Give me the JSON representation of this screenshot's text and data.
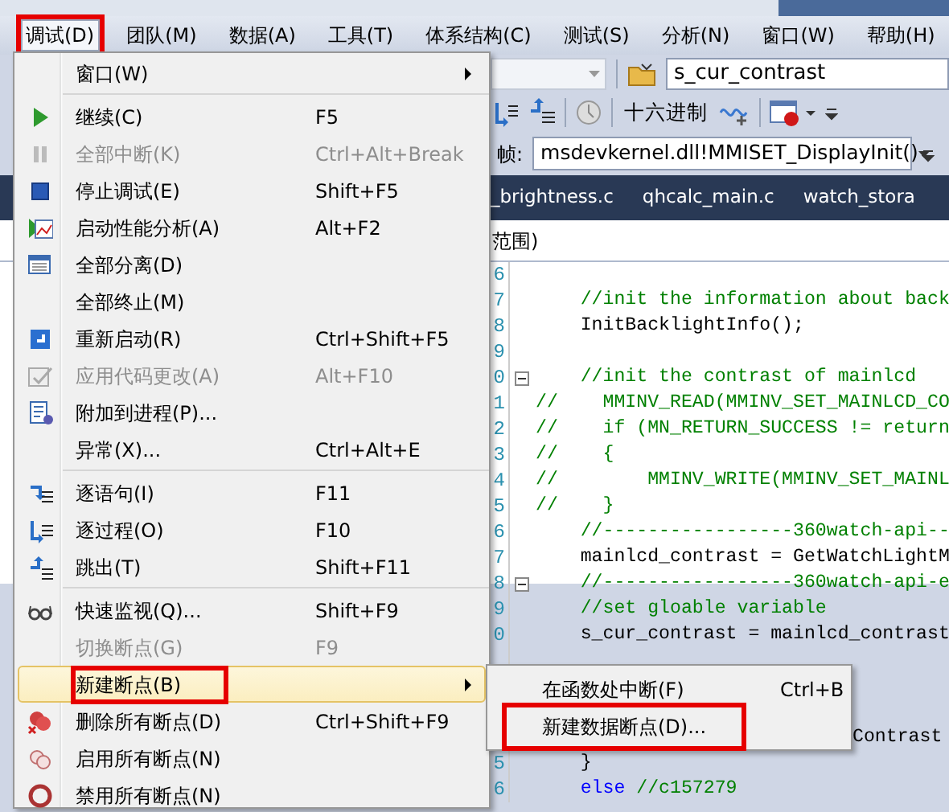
{
  "menubar": [
    {
      "label": "调试(D)",
      "selected": true,
      "annotated": true
    },
    {
      "label": "团队(M)",
      "selected": false,
      "annotated": false
    },
    {
      "label": "数据(A)",
      "selected": false,
      "annotated": false
    },
    {
      "label": "工具(T)",
      "selected": false,
      "annotated": false
    },
    {
      "label": "体系结构(C)",
      "selected": false,
      "annotated": false
    },
    {
      "label": "测试(S)",
      "selected": false,
      "annotated": false
    },
    {
      "label": "分析(N)",
      "selected": false,
      "annotated": false
    },
    {
      "label": "窗口(W)",
      "selected": false,
      "annotated": false
    },
    {
      "label": "帮助(H)",
      "selected": false,
      "annotated": false
    }
  ],
  "toolbar": {
    "find_field": {
      "value": "s_cur_contrast"
    },
    "hex_button": "十六进制",
    "frame_label": "帧:",
    "frame_dropdown": {
      "value": "msdevkernel.dll!MMISET_DisplayInit()"
    }
  },
  "tabs": [
    {
      "label": "_brightness.c"
    },
    {
      "label": "qhcalc_main.c"
    },
    {
      "label": "watch_stora"
    }
  ],
  "scope_text": "范围)",
  "code_lines": [
    {
      "kind": "full",
      "number": "6",
      "fold": false
    },
    {
      "kind": "full",
      "number": "7",
      "fold": false,
      "tokens": [
        {
          "kind": "comment",
          "text": "    //init the information about back"
        }
      ]
    },
    {
      "kind": "full",
      "number": "8",
      "fold": false,
      "tokens": [
        {
          "kind": "code",
          "text": "    InitBacklightInfo();"
        }
      ]
    },
    {
      "kind": "full",
      "number": "9",
      "fold": false
    },
    {
      "kind": "full",
      "number": "0",
      "fold": true,
      "tokens": [
        {
          "kind": "comment",
          "text": "    //init the contrast of mainlcd"
        }
      ]
    },
    {
      "kind": "full",
      "number": "1",
      "fold": false,
      "tokens": [
        {
          "kind": "comment",
          "text": "//    MMINV_READ(MMINV_SET_MAINLCD_CO"
        }
      ]
    },
    {
      "kind": "full",
      "number": "2",
      "fold": false,
      "tokens": [
        {
          "kind": "comment",
          "text": "//    if (MN_RETURN_SUCCESS != return"
        }
      ]
    },
    {
      "kind": "full",
      "number": "3",
      "fold": false,
      "tokens": [
        {
          "kind": "comment",
          "text": "//    {"
        }
      ]
    },
    {
      "kind": "full",
      "number": "4",
      "fold": false,
      "tokens": [
        {
          "kind": "comment",
          "text": "//        MMINV_WRITE(MMINV_SET_MAINL"
        }
      ]
    },
    {
      "kind": "full",
      "number": "5",
      "fold": false,
      "tokens": [
        {
          "kind": "comment",
          "text": "//    }"
        }
      ]
    },
    {
      "kind": "full",
      "number": "6",
      "fold": false,
      "tokens": [
        {
          "kind": "comment",
          "text": "    //-----------------360watch-api--"
        }
      ]
    },
    {
      "kind": "full",
      "number": "7",
      "fold": false,
      "tokens": [
        {
          "kind": "code",
          "text": "    mainlcd_contrast = GetWatchLightM"
        }
      ]
    },
    {
      "kind": "full",
      "number": "8",
      "fold": true,
      "tokens": [
        {
          "kind": "comment",
          "text": "    //-----------------360watch-api-e"
        }
      ]
    },
    {
      "kind": "full",
      "number": "9",
      "fold": false,
      "tokens": [
        {
          "kind": "comment",
          "text": "    //set gloable variable"
        }
      ]
    },
    {
      "kind": "full",
      "number": "0",
      "fold": false,
      "tokens": [
        {
          "kind": "code",
          "text": "    s_cur_contrast = mainlcd_contrast"
        }
      ]
    },
    {
      "kind": "covered"
    },
    {
      "kind": "covered"
    },
    {
      "kind": "covered"
    },
    {
      "kind": "covered",
      "tokens": [
        {
          "kind": "code",
          "text": "Contrast"
        }
      ]
    },
    {
      "kind": "full",
      "number": "5",
      "fold": false,
      "tokens": [
        {
          "kind": "code",
          "text": "    }"
        }
      ]
    },
    {
      "kind": "full",
      "number": "6",
      "fold": false,
      "tokens": [
        {
          "kind": "keyword",
          "text": "    else"
        },
        {
          "kind": "comment",
          "text": " //c157279"
        }
      ]
    }
  ],
  "debug_menu": {
    "items": [
      {
        "kind": "item",
        "label": "窗口(W)",
        "has_submenu": true,
        "disabled": false,
        "highlighted": false,
        "annotated": false
      },
      {
        "kind": "separator"
      },
      {
        "kind": "item",
        "label": "继续(C)",
        "shortcut": "F5",
        "has_submenu": false,
        "disabled": false,
        "highlighted": false,
        "annotated": false
      },
      {
        "kind": "item",
        "label": "全部中断(K)",
        "shortcut": "Ctrl+Alt+Break",
        "has_submenu": false,
        "disabled": true,
        "highlighted": false,
        "annotated": false
      },
      {
        "kind": "item",
        "label": "停止调试(E)",
        "shortcut": "Shift+F5",
        "has_submenu": false,
        "disabled": false,
        "highlighted": false,
        "annotated": false
      },
      {
        "kind": "item",
        "label": "启动性能分析(A)",
        "shortcut": "Alt+F2",
        "has_submenu": false,
        "disabled": false,
        "highlighted": false,
        "annotated": false
      },
      {
        "kind": "item",
        "label": "全部分离(D)",
        "has_submenu": false,
        "disabled": false,
        "highlighted": false,
        "annotated": false
      },
      {
        "kind": "item",
        "label": "全部终止(M)",
        "has_submenu": false,
        "disabled": false,
        "highlighted": false,
        "annotated": false
      },
      {
        "kind": "item",
        "label": "重新启动(R)",
        "shortcut": "Ctrl+Shift+F5",
        "has_submenu": false,
        "disabled": false,
        "highlighted": false,
        "annotated": false
      },
      {
        "kind": "item",
        "label": "应用代码更改(A)",
        "shortcut": "Alt+F10",
        "has_submenu": false,
        "disabled": true,
        "highlighted": false,
        "annotated": false
      },
      {
        "kind": "item",
        "label": "附加到进程(P)...",
        "has_submenu": false,
        "disabled": false,
        "highlighted": false,
        "annotated": false
      },
      {
        "kind": "item",
        "label": "异常(X)...",
        "shortcut": "Ctrl+Alt+E",
        "has_submenu": false,
        "disabled": false,
        "highlighted": false,
        "annotated": false
      },
      {
        "kind": "separator"
      },
      {
        "kind": "item",
        "label": "逐语句(I)",
        "shortcut": "F11",
        "has_submenu": false,
        "disabled": false,
        "highlighted": false,
        "annotated": false
      },
      {
        "kind": "item",
        "label": "逐过程(O)",
        "shortcut": "F10",
        "has_submenu": false,
        "disabled": false,
        "highlighted": false,
        "annotated": false
      },
      {
        "kind": "item",
        "label": "跳出(T)",
        "shortcut": "Shift+F11",
        "has_submenu": false,
        "disabled": false,
        "highlighted": false,
        "annotated": false
      },
      {
        "kind": "separator"
      },
      {
        "kind": "item",
        "label": "快速监视(Q)...",
        "shortcut": "Shift+F9",
        "has_submenu": false,
        "disabled": false,
        "highlighted": false,
        "annotated": false
      },
      {
        "kind": "item",
        "label": "切换断点(G)",
        "shortcut": "F9",
        "has_submenu": false,
        "disabled": true,
        "highlighted": false,
        "annotated": false
      },
      {
        "kind": "item",
        "label": "新建断点(B)",
        "has_submenu": true,
        "disabled": false,
        "highlighted": true,
        "annotated": true
      },
      {
        "kind": "item",
        "label": "删除所有断点(D)",
        "shortcut": "Ctrl+Shift+F9",
        "has_submenu": false,
        "disabled": false,
        "highlighted": false,
        "annotated": false
      },
      {
        "kind": "item",
        "label": "启用所有断点(N)",
        "has_submenu": false,
        "disabled": false,
        "highlighted": false,
        "annotated": false
      },
      {
        "kind": "item",
        "label": "禁用所有断点(N)",
        "has_submenu": false,
        "disabled": false,
        "highlighted": false,
        "annotated": false
      }
    ]
  },
  "submenu": {
    "items": [
      {
        "label": "在函数处中断(F)",
        "shortcut": "Ctrl+B",
        "annotated": false
      },
      {
        "label": "新建数据断点(D)...",
        "annotated": true
      }
    ]
  }
}
